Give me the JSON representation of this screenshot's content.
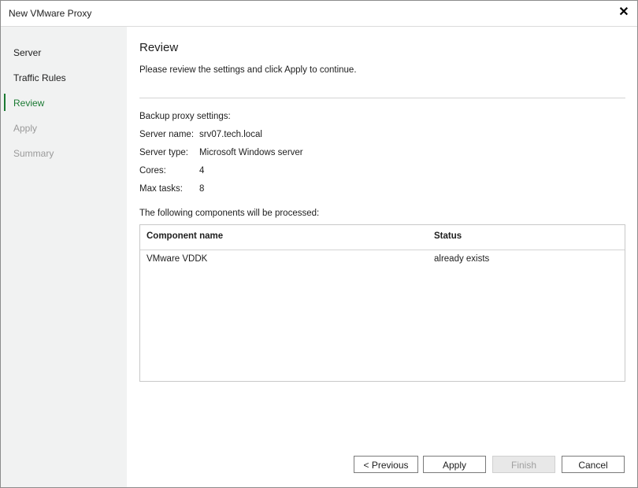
{
  "window": {
    "title": "New VMware Proxy",
    "close_icon": "close-icon"
  },
  "sidebar": {
    "steps": [
      {
        "label": "Server",
        "state": "done"
      },
      {
        "label": "Traffic Rules",
        "state": "done"
      },
      {
        "label": "Review",
        "state": "current"
      },
      {
        "label": "Apply",
        "state": "disabled"
      },
      {
        "label": "Summary",
        "state": "disabled"
      }
    ]
  },
  "main": {
    "heading": "Review",
    "description": "Please review the settings and click Apply to continue.",
    "settings_label": "Backup proxy settings:",
    "settings": [
      {
        "key": "Server name:",
        "value": "srv07.tech.local"
      },
      {
        "key": "Server type:",
        "value": "Microsoft Windows server"
      },
      {
        "key": "Cores:",
        "value": "4"
      },
      {
        "key": "Max tasks:",
        "value": "8"
      }
    ],
    "components_label": "The following components will be processed:",
    "table": {
      "columns": [
        "Component name",
        "Status"
      ],
      "rows": [
        [
          "VMware VDDK",
          "already exists"
        ]
      ]
    }
  },
  "buttons": {
    "previous": "< Previous",
    "apply": "Apply",
    "finish": "Finish",
    "cancel": "Cancel"
  },
  "colors": {
    "accent": "#1b7a33",
    "sidebar_bg": "#f1f2f2"
  }
}
